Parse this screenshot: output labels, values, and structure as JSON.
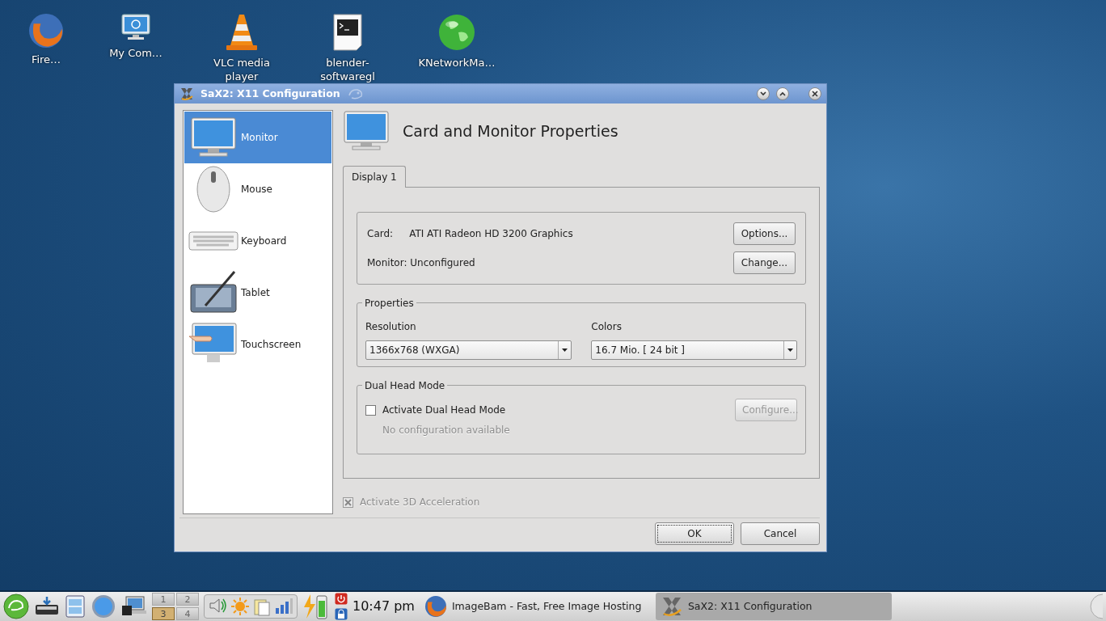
{
  "desktop_icons": [
    {
      "kind": "firefox",
      "label": "Fire…"
    },
    {
      "kind": "computer",
      "label": "My Com…"
    },
    {
      "kind": "cone",
      "label": "VLC media player"
    },
    {
      "kind": "terminal",
      "label": "blender-softwaregl"
    },
    {
      "kind": "globe",
      "label": "KNetworkMa…"
    }
  ],
  "window": {
    "title": "SaX2: X11 Configuration",
    "sidebar": [
      {
        "kind": "monitor",
        "label": "Monitor",
        "selected": true
      },
      {
        "kind": "mouse",
        "label": "Mouse",
        "selected": false
      },
      {
        "kind": "keyboard",
        "label": "Keyboard",
        "selected": false
      },
      {
        "kind": "tablet",
        "label": "Tablet",
        "selected": false
      },
      {
        "kind": "touchscreen",
        "label": "Touchscreen",
        "selected": false
      }
    ],
    "heading": "Card and Monitor Properties",
    "tabs": [
      {
        "label": "Display 1",
        "selected": true
      }
    ],
    "card": {
      "label": "Card:",
      "value": "ATI ATI Radeon HD 3200 Graphics",
      "button": "Options..."
    },
    "monitor": {
      "label": "Monitor: Unconfigured",
      "button": "Change..."
    },
    "properties": {
      "title": "Properties",
      "resolution": {
        "label": "Resolution",
        "value": "1366x768 (WXGA)"
      },
      "colors": {
        "label": "Colors",
        "value": "16.7 Mio. [ 24 bit ]"
      }
    },
    "dual_head": {
      "title": "Dual Head Mode",
      "checkbox": {
        "label": "Activate Dual Head Mode",
        "checked": false
      },
      "note": "No configuration available",
      "button": {
        "label": "Configure...",
        "disabled": true
      }
    },
    "acceleration": {
      "label": "Activate 3D Acceleration",
      "checked": true,
      "disabled": true
    },
    "buttons": [
      {
        "label": "OK",
        "default": true
      },
      {
        "label": "Cancel",
        "default": false
      }
    ]
  },
  "taskbar": {
    "pager": [
      {
        "label": "1",
        "selected": false
      },
      {
        "label": "2",
        "selected": false
      },
      {
        "label": "3",
        "selected": true
      },
      {
        "label": "4",
        "selected": false
      }
    ],
    "clock": "10:47 pm",
    "tasks": [
      {
        "kind": "firefox",
        "label": "ImageBam - Fast, Free Image Hosting",
        "selected": false
      },
      {
        "kind": "sax",
        "label": "SaX2: X11 Configuration",
        "selected": true
      }
    ]
  }
}
